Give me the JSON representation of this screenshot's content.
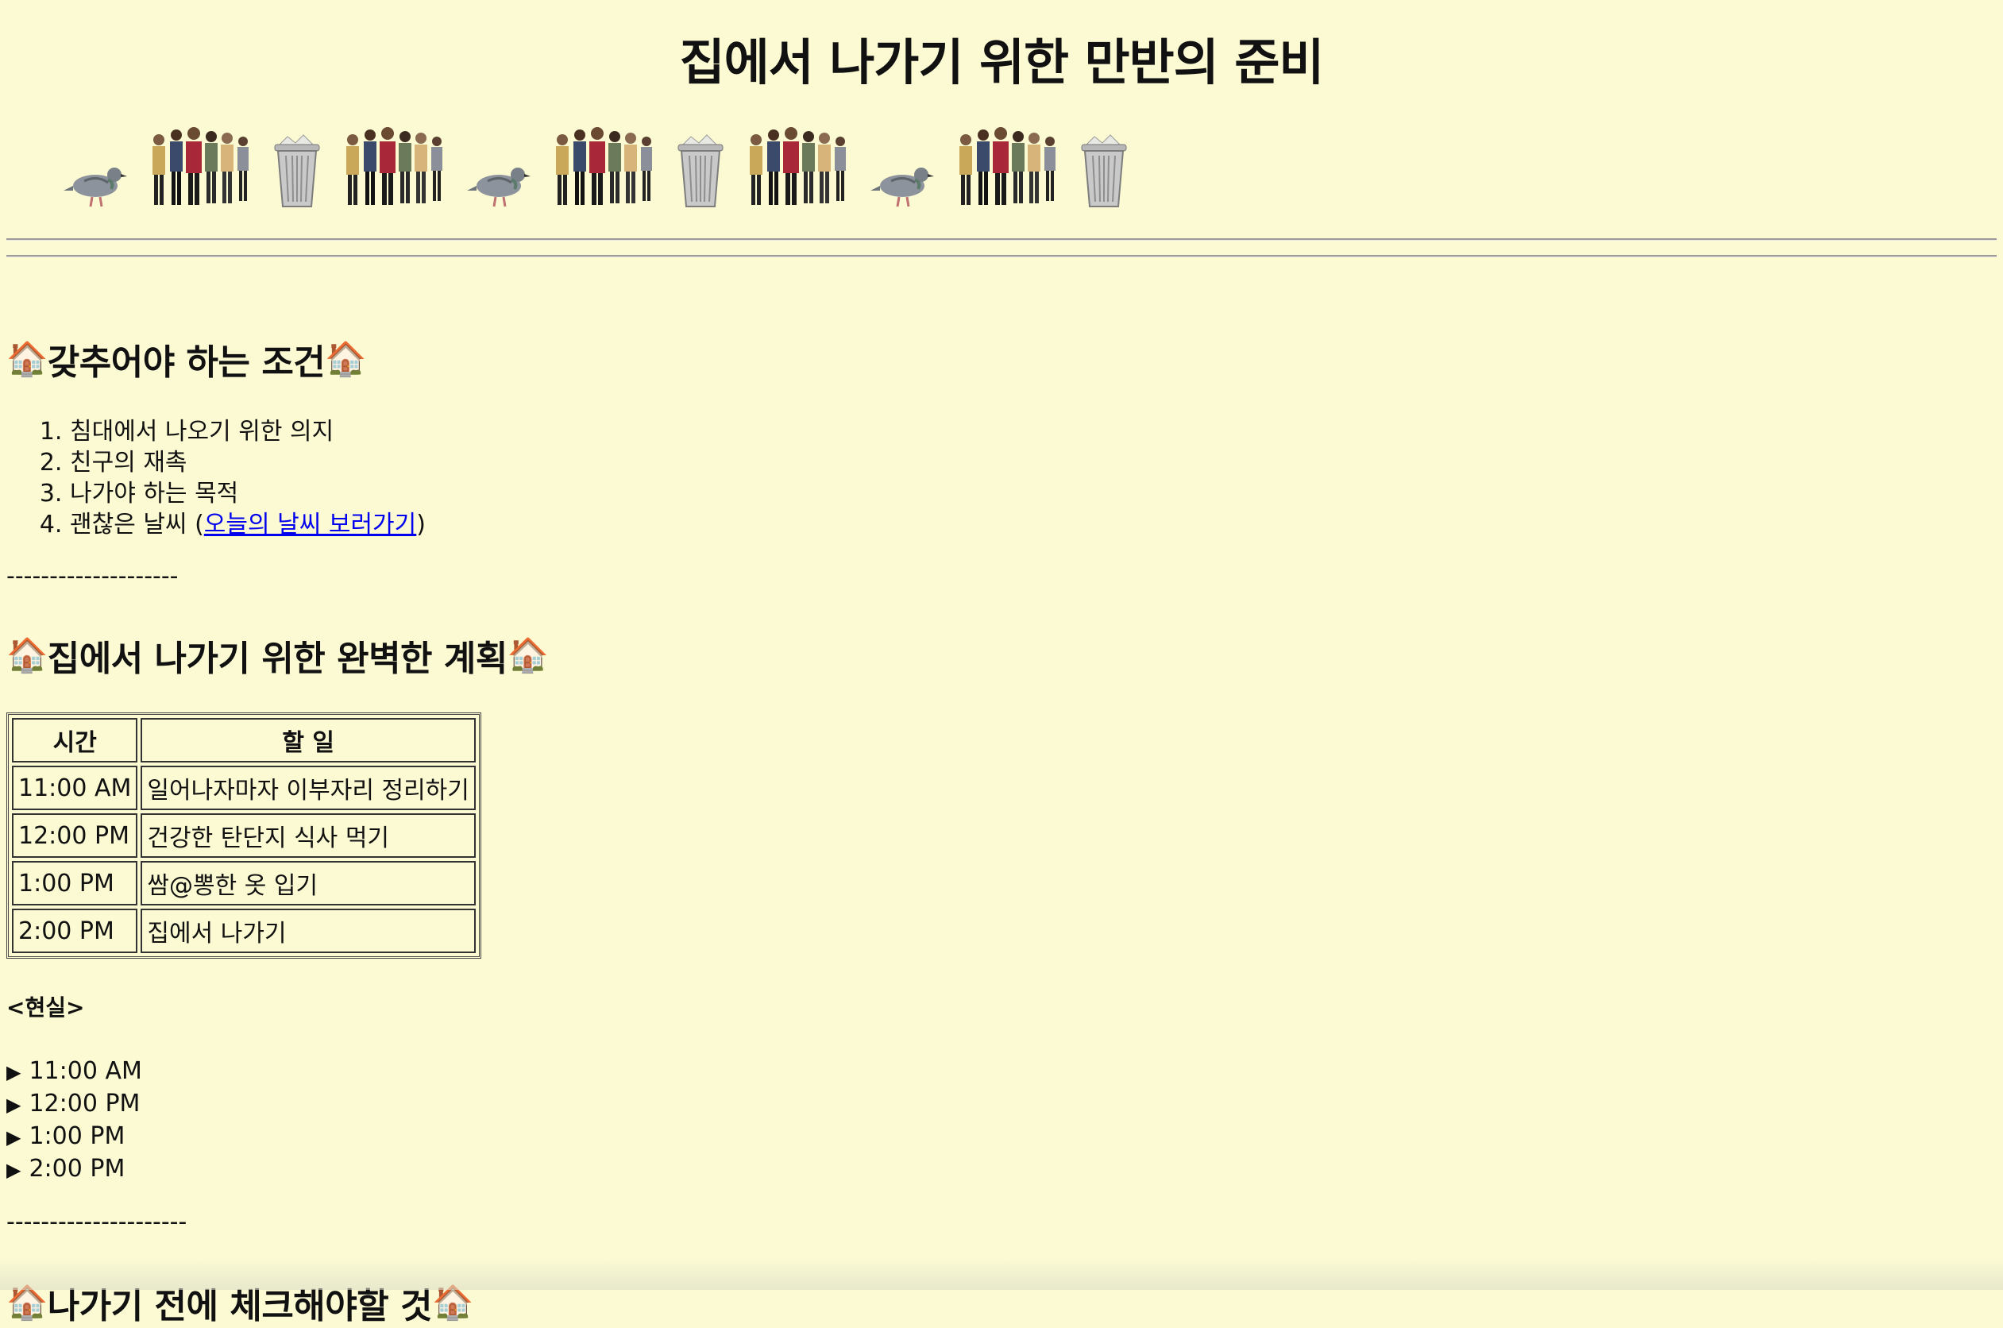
{
  "page": {
    "title": "집에서 나가기 위한 만반의 준비",
    "background_color": "#fbfad3",
    "link_color": "#0000ee"
  },
  "image_strip": [
    "pigeon-icon",
    "crowd-icon",
    "trash-can-icon",
    "crowd-icon",
    "pigeon-icon",
    "crowd-icon",
    "trash-can-icon",
    "crowd-icon",
    "pigeon-icon",
    "crowd-icon",
    "trash-can-icon"
  ],
  "house_emoji": "🏠",
  "conditions": {
    "heading": "갖추어야 하는 조건",
    "items": [
      {
        "number": "1.",
        "text": "침대에서 나오기 위한 의지"
      },
      {
        "number": "2.",
        "text": "친구의 재촉"
      },
      {
        "number": "3.",
        "text": "나가야 하는 목적"
      },
      {
        "number": "4.",
        "text": "괜찮은 날씨 (",
        "link": "오늘의 날씨 보러가기",
        "after": ")"
      }
    ]
  },
  "divider1": "--------------------",
  "plan": {
    "heading": "집에서 나가기 위한 완벽한 계획",
    "columns": [
      "시간",
      "할 일"
    ],
    "rows": [
      {
        "time": "11:00 AM",
        "task": "일어나자마자 이부자리 정리하기"
      },
      {
        "time": "12:00 PM",
        "task": "건강한 탄단지 식사 먹기"
      },
      {
        "time": "1:00 PM",
        "task": "쌈@뽕한 옷 입기"
      },
      {
        "time": "2:00 PM",
        "task": "집에서 나가기"
      }
    ]
  },
  "reality": {
    "title": "<현실>",
    "items": [
      "11:00 AM",
      "12:00 PM",
      "1:00 PM",
      "2:00 PM"
    ],
    "marker": "▶"
  },
  "divider2": "---------------------",
  "checklist": {
    "heading": "나가기 전에 체크해야할 것"
  }
}
